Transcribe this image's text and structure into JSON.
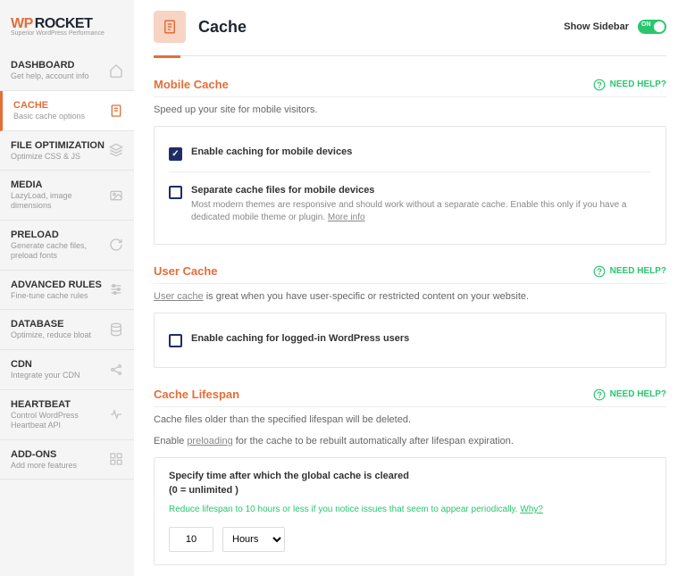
{
  "logo": {
    "wp": "WP",
    "rocket": "ROCKET",
    "tagline": "Superior WordPress Performance"
  },
  "nav": [
    {
      "title": "DASHBOARD",
      "desc": "Get help, account info",
      "icon": "home"
    },
    {
      "title": "CACHE",
      "desc": "Basic cache options",
      "icon": "doc",
      "active": true
    },
    {
      "title": "FILE OPTIMIZATION",
      "desc": "Optimize CSS & JS",
      "icon": "stack"
    },
    {
      "title": "MEDIA",
      "desc": "LazyLoad, image dimensions",
      "icon": "image"
    },
    {
      "title": "PRELOAD",
      "desc": "Generate cache files, preload fonts",
      "icon": "refresh"
    },
    {
      "title": "ADVANCED RULES",
      "desc": "Fine-tune cache rules",
      "icon": "sliders"
    },
    {
      "title": "DATABASE",
      "desc": "Optimize, reduce bloat",
      "icon": "db"
    },
    {
      "title": "CDN",
      "desc": "Integrate your CDN",
      "icon": "share"
    },
    {
      "title": "HEARTBEAT",
      "desc": "Control WordPress Heartbeat API",
      "icon": "heart"
    },
    {
      "title": "ADD-ONS",
      "desc": "Add more features",
      "icon": "addon"
    }
  ],
  "header": {
    "title": "Cache",
    "show_sidebar": "Show Sidebar",
    "toggle": "ON"
  },
  "help": "NEED HELP?",
  "sections": {
    "mobile": {
      "title": "Mobile Cache",
      "desc": "Speed up your site for mobile visitors.",
      "opt1": {
        "label": "Enable caching for mobile devices",
        "checked": true
      },
      "opt2": {
        "label": "Separate cache files for mobile devices",
        "checked": false,
        "desc": "Most modern themes are responsive and should work without a separate cache. Enable this only if you have a dedicated mobile theme or plugin.",
        "more": "More info"
      }
    },
    "user": {
      "title": "User Cache",
      "link": "User cache",
      "desc": " is great when you have user-specific or restricted content on your website.",
      "opt1": {
        "label": "Enable caching for logged-in WordPress users",
        "checked": false
      }
    },
    "lifespan": {
      "title": "Cache Lifespan",
      "desc1": "Cache files older than the specified lifespan will be deleted.",
      "enable": "Enable ",
      "preload_link": "preloading",
      "desc2": " for the cache to be rebuilt automatically after lifespan expiration.",
      "panel_title": "Specify time after which the global cache is cleared",
      "panel_sub": "(0 = unlimited )",
      "tip": "Reduce lifespan to 10 hours or less if you notice issues that seem to appear periodically. ",
      "why": "Why?",
      "value": "10",
      "unit": "Hours"
    }
  }
}
